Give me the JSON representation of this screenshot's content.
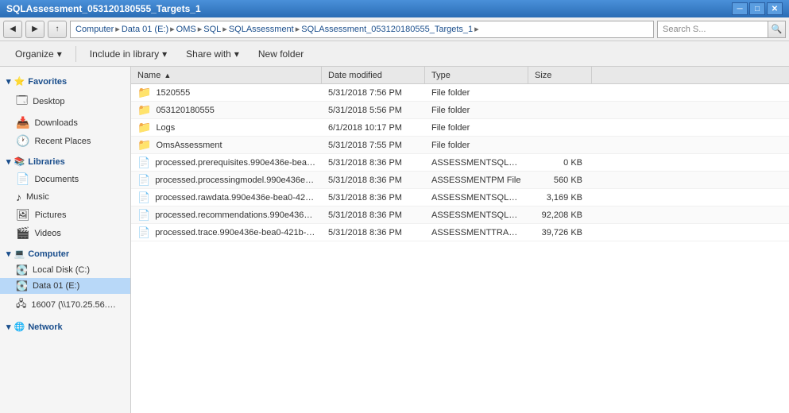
{
  "titlebar": {
    "title": "SQLAssessment_053120180555_Targets_1"
  },
  "addressbar": {
    "path": "Computer ▸ Data 01 (E:) ▸ OMS ▸ SQL ▸ SQLAssessment ▸ SQLAssessment_053120180555_Targets_1",
    "search_placeholder": "Search S..."
  },
  "toolbar": {
    "organize_label": "Organize",
    "include_label": "Include in library",
    "share_label": "Share with",
    "newfolder_label": "New folder"
  },
  "sidebar": {
    "favorites_header": "Favorites",
    "favorites_items": [
      {
        "label": "Desktop",
        "icon": "🗔"
      },
      {
        "label": "Downloads",
        "icon": "📥"
      },
      {
        "label": "Recent Places",
        "icon": "🕐"
      }
    ],
    "libraries_header": "Libraries",
    "libraries_items": [
      {
        "label": "Documents",
        "icon": "📄"
      },
      {
        "label": "Music",
        "icon": "♪"
      },
      {
        "label": "Pictures",
        "icon": "🖼"
      },
      {
        "label": "Videos",
        "icon": "🎬"
      }
    ],
    "computer_header": "Computer",
    "computer_items": [
      {
        "label": "Local Disk (C:)",
        "icon": "💽"
      },
      {
        "label": "Data 01 (E:)",
        "icon": "💽",
        "active": true
      },
      {
        "label": "16007 (\\\\170.25.56.2...",
        "icon": "🖧"
      }
    ],
    "network_header": "Network"
  },
  "columns": {
    "name": "Name",
    "date_modified": "Date modified",
    "type": "Type",
    "size": "Size"
  },
  "files": [
    {
      "name": "1520555",
      "date": "5/31/2018 7:56 PM",
      "type": "File folder",
      "size": "",
      "is_folder": true
    },
    {
      "name": "053120180555",
      "date": "5/31/2018 5:56 PM",
      "type": "File folder",
      "size": "",
      "is_folder": true
    },
    {
      "name": "Logs",
      "date": "6/1/2018 10:17 PM",
      "type": "File folder",
      "size": "",
      "is_folder": true
    },
    {
      "name": "OmsAssessment",
      "date": "5/31/2018 7:55 PM",
      "type": "File folder",
      "size": "",
      "is_folder": true
    },
    {
      "name": "processed.prerequisites.990e436e-bea0-42...",
      "date": "5/31/2018 8:36 PM",
      "type": "ASSESSMENTSQLRE...",
      "size": "0 KB",
      "is_folder": false
    },
    {
      "name": "processed.processingmodel.990e436e-bea0-...",
      "date": "5/31/2018 8:36 PM",
      "type": "ASSESSMENTPM File",
      "size": "560 KB",
      "is_folder": false
    },
    {
      "name": "processed.rawdata.990e436e-bea0-421b-8...",
      "date": "5/31/2018 8:36 PM",
      "type": "ASSESSMENTSQLR...",
      "size": "3,169 KB",
      "is_folder": false
    },
    {
      "name": "processed.recommendations.990e436e-bea...",
      "date": "5/31/2018 8:36 PM",
      "type": "ASSESSMENTSQLRE...",
      "size": "92,208 KB",
      "is_folder": false
    },
    {
      "name": "processed.trace.990e436e-bea0-421b-845c-...",
      "date": "5/31/2018 8:36 PM",
      "type": "ASSESSMENTTRAC...",
      "size": "39,726 KB",
      "is_folder": false
    }
  ]
}
